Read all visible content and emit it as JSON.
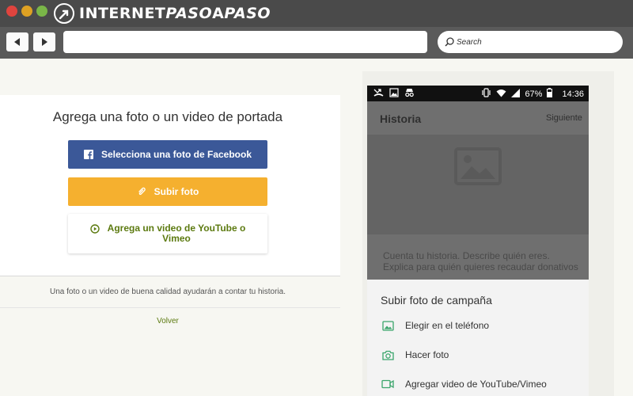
{
  "browser": {
    "logo_text_a": "INTERNET",
    "logo_text_b": "PASO",
    "logo_text_c": "A",
    "logo_text_d": "PASO",
    "search_label": "Search",
    "url_value": ""
  },
  "page": {
    "title": "Agrega una foto o un video de portada",
    "fb_button": "Selecciona una foto de Facebook",
    "upload_button": "Subir foto",
    "youtube_button_line1": "Agrega un video de YouTube o",
    "youtube_button_line2": "Vimeo",
    "hint": "Una foto o un video de buena calidad ayudarán a contar tu historia.",
    "back_link": "Volver"
  },
  "phone": {
    "battery": "67%",
    "time": "14:36",
    "header_title": "Historia",
    "header_next": "Siguiente",
    "story_placeholder": "Cuenta tu historia. Describe quién eres. Explica para quién quieres recaudar donativos",
    "sheet_title": "Subir foto de campaña",
    "sheet_items": [
      {
        "label": "Elegir en el teléfono",
        "icon": "image-icon"
      },
      {
        "label": "Hacer foto",
        "icon": "camera-icon"
      },
      {
        "label": "Agregar video de YouTube/Vimeo",
        "icon": "video-icon"
      }
    ]
  },
  "colors": {
    "facebook": "#3b5898",
    "upload": "#f5b02f",
    "accent_green": "#5c7a10",
    "sheet_icon": "#3aa56b"
  }
}
